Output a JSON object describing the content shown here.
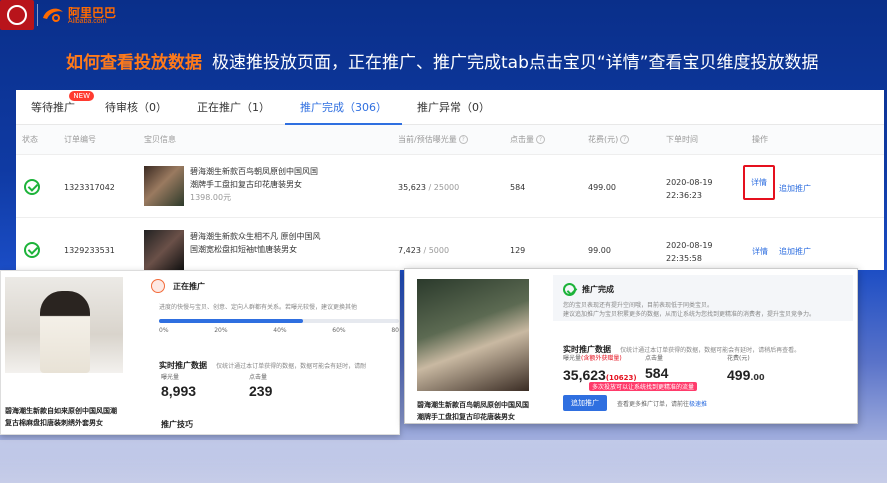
{
  "header": {
    "alibaba_cn": "阿里巴巴",
    "alibaba_en": "Alibaba.com",
    "headline_highlight": "如何查看投放数据",
    "headline_text": "极速推投放页面，正在推广、推广完成tab点击宝贝“详情”查看宝贝维度投放数据"
  },
  "tabs": [
    {
      "label": "等待推广",
      "badge": "NEW"
    },
    {
      "label": "待审核（0）"
    },
    {
      "label": "正在推广（1）"
    },
    {
      "label": "推广完成（306）",
      "active": true
    },
    {
      "label": "推广异常（0）"
    }
  ],
  "columns": [
    "状态",
    "订单编号",
    "宝贝信息",
    "当前/预估曝光量",
    "点击量",
    "花费(元)",
    "下单时间",
    "操作"
  ],
  "rows": [
    {
      "order": "1323317042",
      "title1": "碧海潮生新款百鸟朝凤原创中国风国",
      "title2": "潮牌手工盘扣复古印花唐装男女",
      "price": "1398.00元",
      "exposure_current": "35,623",
      "exposure_est": "/ 25000",
      "clicks": "584",
      "cost": "499.00",
      "date": "2020-08-19",
      "time": "22:36:23",
      "action_detail": "详情",
      "action_add": "追加推广"
    },
    {
      "order": "1329233531",
      "title1": "碧海潮生新款众生相不凡 原创中国风",
      "title2": "国潮宽松盘扣短袖t恤唐装男女",
      "exposure_current": "7,423",
      "exposure_est": "/ 5000",
      "clicks": "129",
      "cost": "99.00",
      "date": "2020-08-19",
      "time": "22:35:58",
      "action_detail": "详情",
      "action_add": "追加推广"
    }
  ],
  "card_left": {
    "status": "正在推广",
    "desc": "进度的快慢与宝贝、创意、定向人群都有关系。若曝光较慢，建议更换其他",
    "progress_ticks": [
      "0%",
      "20%",
      "40%",
      "60%",
      "80"
    ],
    "progress_value": 0.6,
    "realtime_title": "实时推广数据",
    "realtime_note": "仅统计通过本订单获得的数据，数据可能会有延时，请耐",
    "exposure_label": "曝光量",
    "exposure_value": "8,993",
    "click_label": "点击量",
    "click_value": "239",
    "tips_title": "推广技巧",
    "caption1": "碧海潮生新款自如来原创中国风国潮",
    "caption2": "复古棉麻盘扣唐装刺绣外套男女"
  },
  "card_right": {
    "status": "推广完成",
    "desc1": "您的宝贝表现还有提升空间哦，目前表现低于同类宝贝。",
    "desc2": "建议追加推广为宝贝积累更多的数据，从而让系统为您找到更精准的消费者，提升宝贝竞争力。",
    "realtime_title": "实时推广数据",
    "realtime_note": "仅统计通过本订单获得的数据，数据可能会有延时，请稍后再查看。",
    "exposure_label": "曝光量",
    "exposure_extra": "(含额外获赠量)",
    "exposure_value": "35,623",
    "exposure_bonus": "(10623)",
    "click_label": "点击量",
    "click_value": "584",
    "cost_label": "花费(元)",
    "cost_value": "499",
    "cost_decimal": ".00",
    "tooltip": "多次投放可以让系统找到更精准的流量",
    "button": "追加推广",
    "more_text": "查看更多推广订单，请前往",
    "more_link": "极速推",
    "caption1": "碧海潮生新款百鸟朝凤原创中国风国",
    "caption2": "潮牌手工盘扣复古印花唐装男女"
  },
  "colors": {
    "accent": "#2f6fe0",
    "success": "#1db33a",
    "highlight": "#ff7a1a",
    "alert": "#e5101e"
  }
}
